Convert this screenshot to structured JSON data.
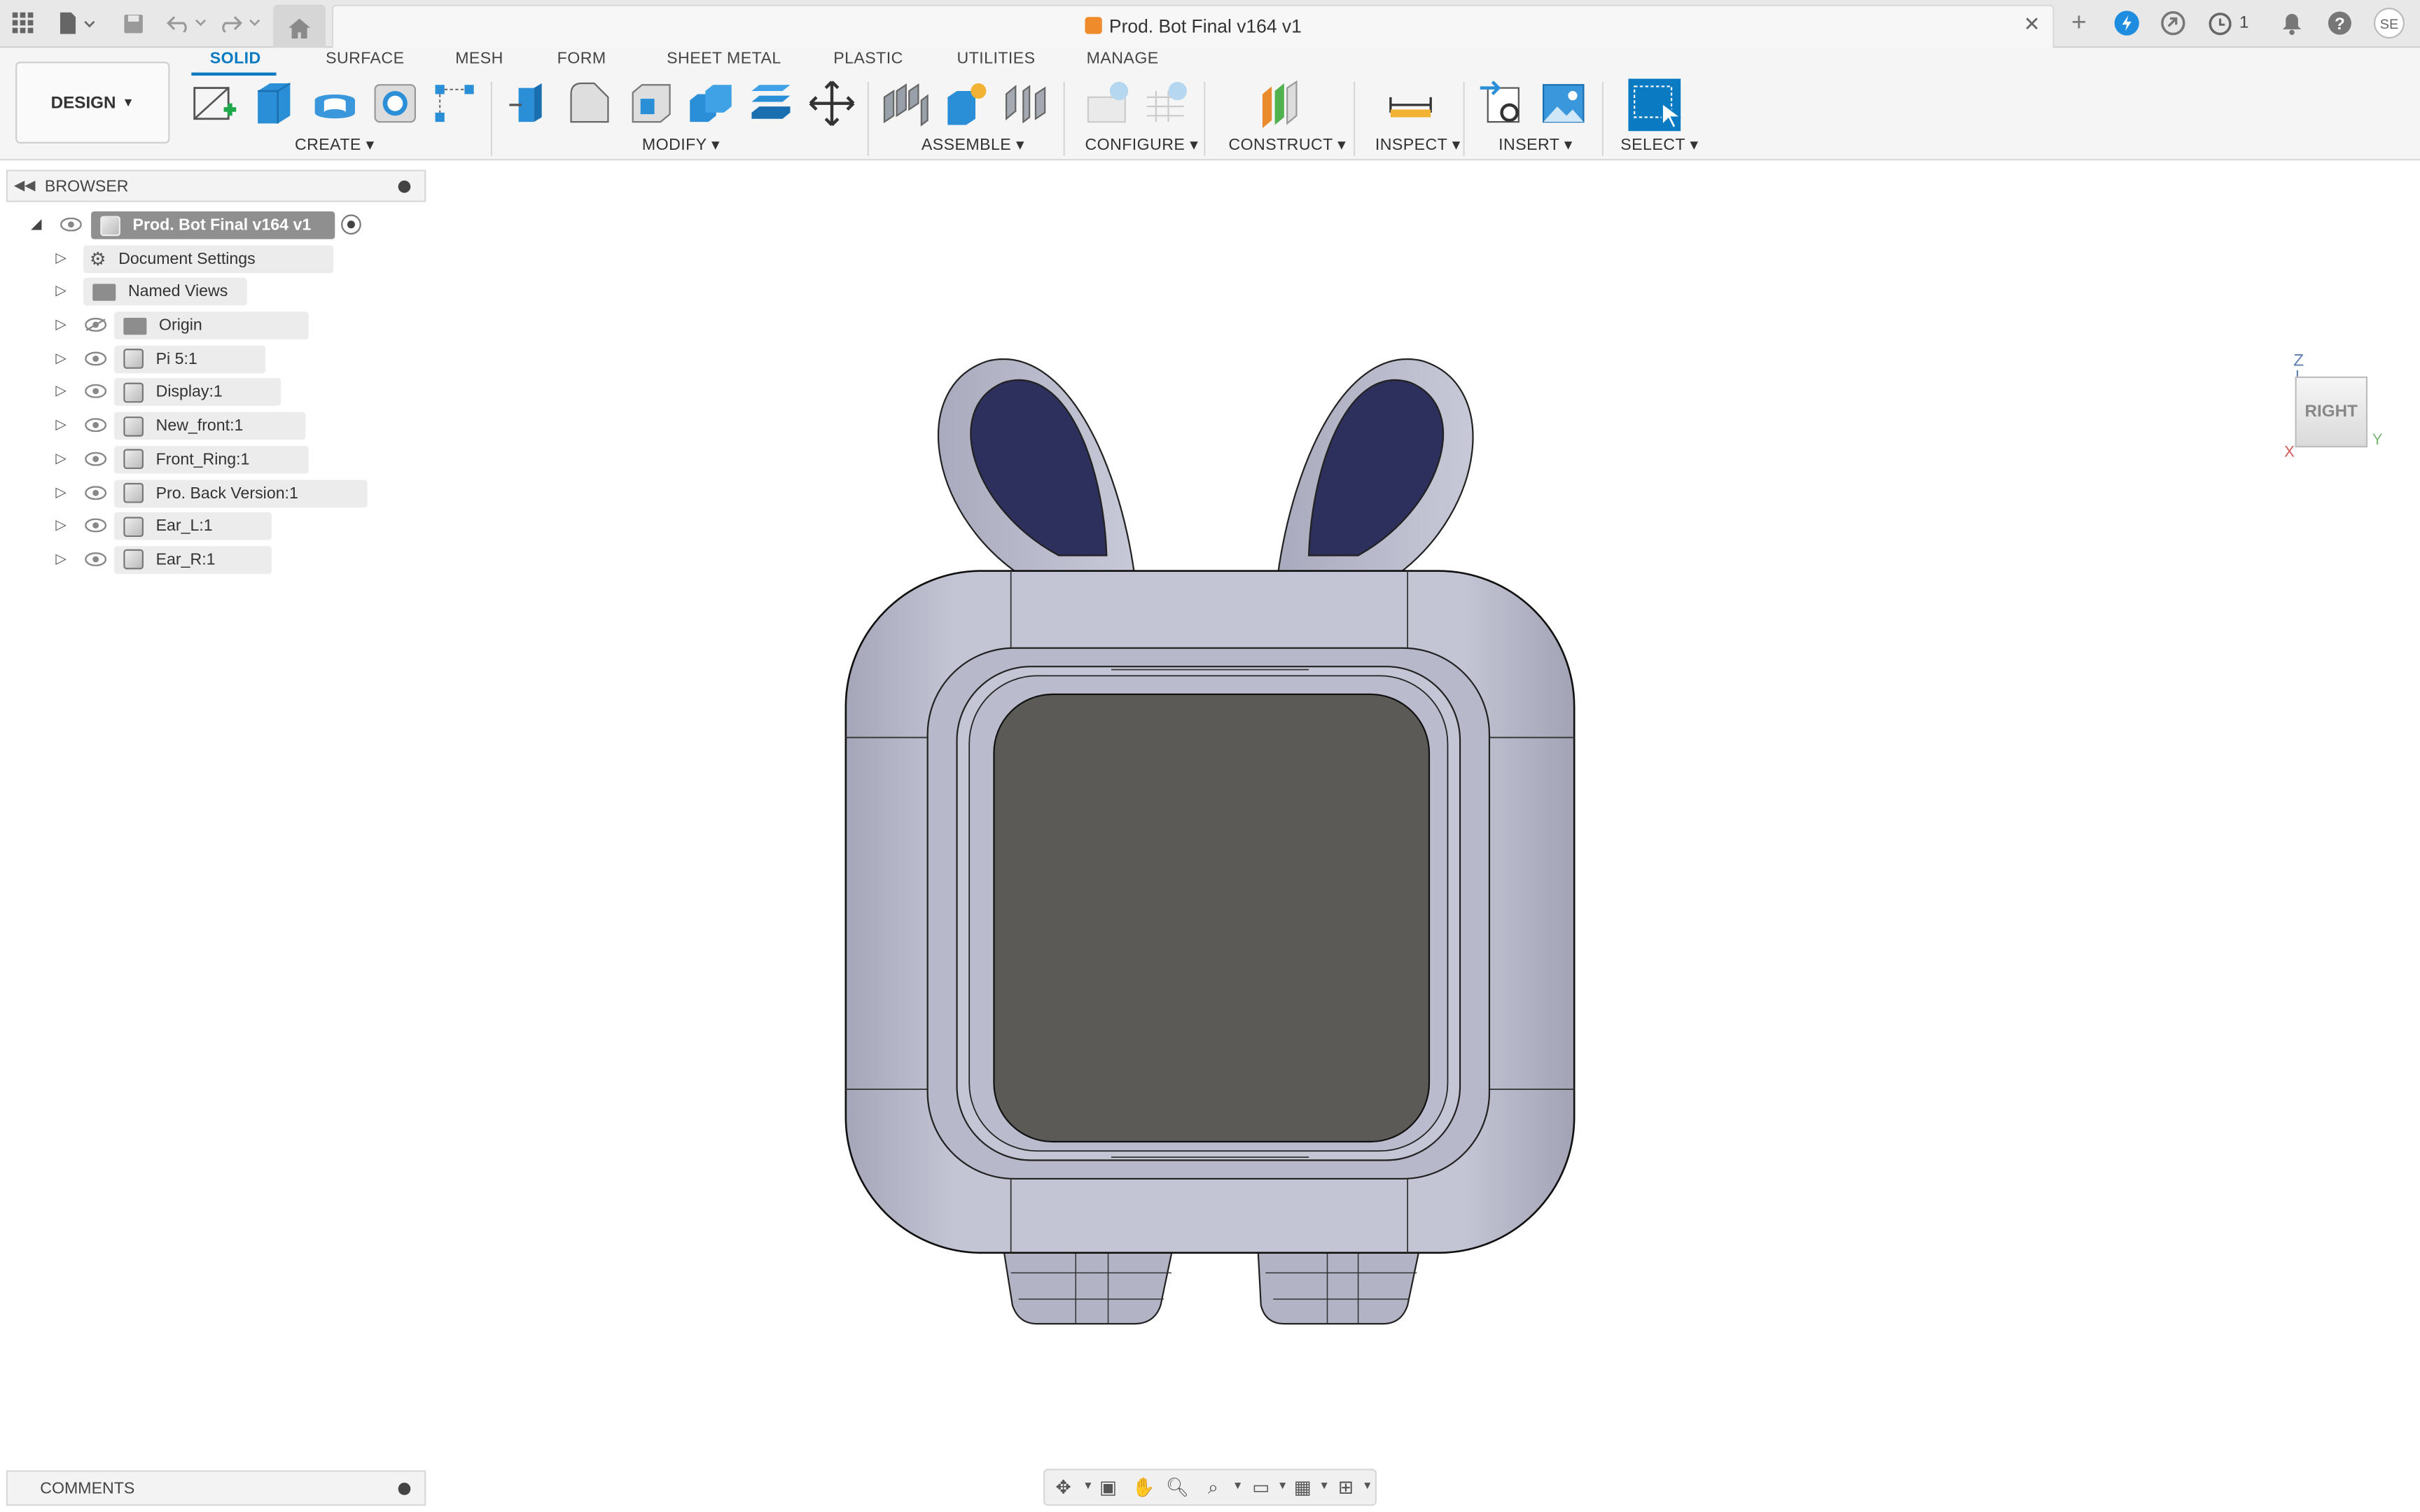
{
  "titlebar": {
    "doc_title": "Prod. Bot Final v164 v1",
    "notification_count": "1",
    "icons": [
      "app-grid-icon",
      "file-icon",
      "save-icon",
      "undo-icon",
      "redo-icon",
      "home-icon",
      "new-tab-icon",
      "online-status-icon",
      "extensions-icon",
      "job-status-icon",
      "notifications-icon",
      "help-icon",
      "account-icon"
    ]
  },
  "toolbar": {
    "design_label": "DESIGN",
    "tabs": [
      "SOLID",
      "SURFACE",
      "MESH",
      "FORM",
      "SHEET METAL",
      "PLASTIC",
      "UTILITIES",
      "MANAGE"
    ],
    "active_tab": "SOLID",
    "groups": [
      "CREATE",
      "MODIFY",
      "ASSEMBLE",
      "CONFIGURE",
      "CONSTRUCT",
      "INSPECT",
      "INSERT",
      "SELECT"
    ]
  },
  "browser": {
    "title": "BROWSER",
    "root": "Prod. Bot Final v164 v1",
    "items": [
      {
        "label": "Document Settings",
        "icon": "gear-icon"
      },
      {
        "label": "Named Views",
        "icon": "folder-icon"
      },
      {
        "label": "Origin",
        "icon": "folder-icon"
      },
      {
        "label": "Pi 5:1",
        "icon": "component-icon"
      },
      {
        "label": "Display:1",
        "icon": "component-icon"
      },
      {
        "label": "New_front:1",
        "icon": "component-icon"
      },
      {
        "label": "Front_Ring:1",
        "icon": "component-icon"
      },
      {
        "label": "Pro. Back Version:1",
        "icon": "component-icon"
      },
      {
        "label": "Ear_L:1",
        "icon": "body-icon"
      },
      {
        "label": "Ear_R:1",
        "icon": "body-icon"
      }
    ]
  },
  "viewcube": {
    "face": "RIGHT",
    "axis_z": "Z",
    "axis_y": "Y",
    "axis_x": "X"
  },
  "comments": {
    "title": "COMMENTS"
  },
  "colors": {
    "accent": "#0a7bc2",
    "model_body": "#b9bacb",
    "screen": "#5b5a57",
    "ear_inner": "#2d2f5c"
  }
}
